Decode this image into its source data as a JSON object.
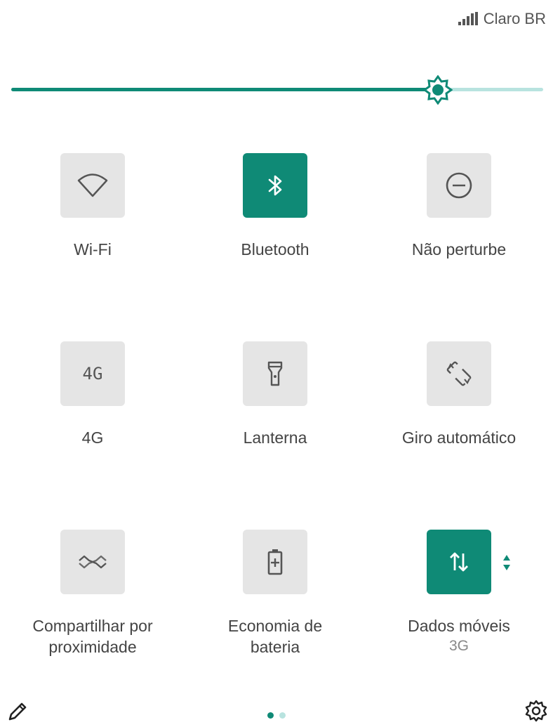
{
  "status": {
    "carrier": "Claro BR",
    "signal_icon": "signal-icon"
  },
  "brightness": {
    "level": 0.802,
    "accent": "#0f8a76",
    "track": "#b8e3df"
  },
  "tiles": [
    {
      "label": "Wi-Fi",
      "icon": "wifi-icon",
      "active": false
    },
    {
      "label": "Bluetooth",
      "icon": "bluetooth-icon",
      "active": true
    },
    {
      "label": "Não perturbe",
      "icon": "do-not-disturb-icon",
      "active": false
    },
    {
      "label": "4G",
      "icon": "4g-icon",
      "icon_text": "4G",
      "active": false
    },
    {
      "label": "Lanterna",
      "icon": "flashlight-icon",
      "active": false
    },
    {
      "label": "Giro automático",
      "icon": "auto-rotate-icon",
      "active": false
    },
    {
      "label": "Compartilhar por proximidade",
      "label_line1": "Compartilhar por",
      "label_line2": "proximidade",
      "icon": "nearby-share-icon",
      "active": false
    },
    {
      "label": "Economia de bateria",
      "label_line1": "Economia de",
      "label_line2": "bateria",
      "icon": "battery-saver-icon",
      "active": false
    },
    {
      "label": "Dados móveis",
      "sub": "3G",
      "icon": "mobile-data-icon",
      "active": true
    }
  ],
  "footer": {
    "edit_icon": "pencil-icon",
    "settings_icon": "gear-icon",
    "pages": 2,
    "current_page": 1
  }
}
